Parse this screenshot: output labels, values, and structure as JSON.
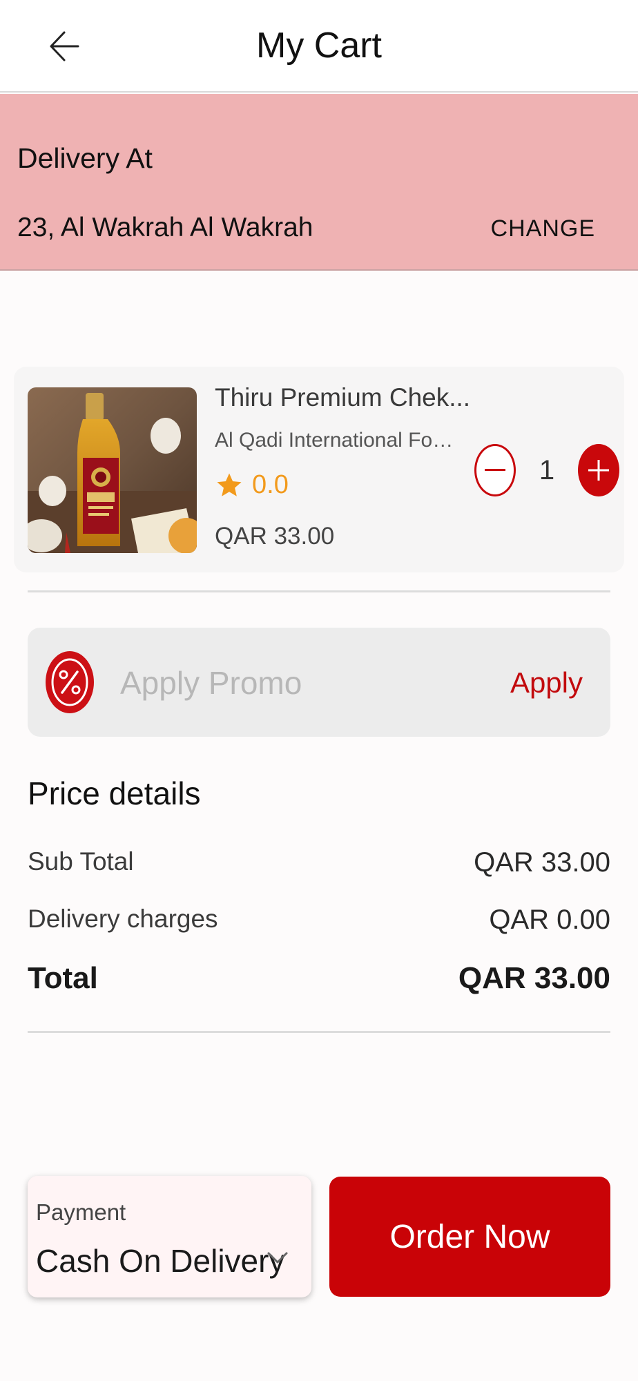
{
  "header": {
    "title": "My Cart",
    "back_icon": "arrow-left-icon"
  },
  "delivery": {
    "heading": "Delivery At",
    "address": "23, Al Wakrah Al Wakrah",
    "change_label": "CHANGE"
  },
  "cart": {
    "items": [
      {
        "name": "Thiru Premium Chek...",
        "vendor": "Al Qadi International Foo...",
        "rating": "0.0",
        "price": "QAR 33.00",
        "quantity": "1"
      }
    ]
  },
  "promo": {
    "placeholder": "Apply Promo",
    "value": "",
    "apply_label": "Apply"
  },
  "price_details": {
    "title": "Price details",
    "rows": [
      {
        "label": "Sub Total",
        "value": "QAR 33.00"
      },
      {
        "label": "Delivery charges",
        "value": "QAR 0.00"
      }
    ],
    "total": {
      "label": "Total",
      "value": "QAR 33.00"
    }
  },
  "footer": {
    "payment_label": "Payment",
    "payment_value": "Cash On Delivery",
    "order_label": "Order Now"
  },
  "colors": {
    "brand_red": "#c9080b",
    "delivery_band": "#efb2b3",
    "rating_orange": "#f29a1c"
  }
}
